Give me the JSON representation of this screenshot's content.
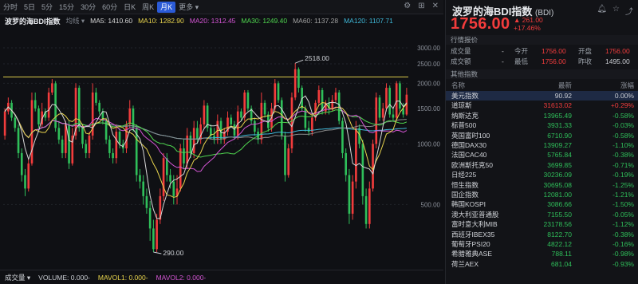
{
  "toolbar": {
    "tabs": [
      "分时",
      "5日",
      "5分",
      "15分",
      "30分",
      "60分",
      "日K",
      "周K",
      "月K",
      "更多"
    ],
    "active_tab": 8
  },
  "indicator_row": {
    "title": "波罗的海BDI指数",
    "mode": "均线",
    "ma5": "MA5: 1410.60",
    "ma10": "MA10: 1282.90",
    "ma20": "MA20: 1312.45",
    "ma30": "MA30: 1249.40",
    "ma60": "MA60: 1137.28",
    "ma120": "MA120: 1107.71",
    "colors": {
      "ma5": "#d7d7d7",
      "ma10": "#e8d44d",
      "ma20": "#d455d4",
      "ma30": "#4fd64f",
      "ma60": "#8c8c8c",
      "ma120": "#3fb8d8"
    }
  },
  "chart_data": {
    "type": "candlestick",
    "y_scale": "log",
    "ylim": [
      260,
      3600
    ],
    "y_ticks": [
      "3000.00",
      "2500.00",
      "2000.00",
      "1500.00",
      "1000.00",
      "500.00"
    ],
    "high_label": "2518.00",
    "low_label": "290.00",
    "high": 2518,
    "low": 290,
    "reference_line": 2150,
    "up_color": "#f23c3c",
    "down_color": "#2fbf5a",
    "candles": [
      [
        1100,
        1450,
        1050,
        1500
      ],
      [
        1450,
        1600,
        1400,
        1700
      ],
      [
        1600,
        1350,
        1300,
        1650
      ],
      [
        1350,
        1200,
        1150,
        1400
      ],
      [
        1200,
        900,
        850,
        1250
      ],
      [
        900,
        700,
        650,
        950
      ],
      [
        700,
        600,
        550,
        750
      ],
      [
        600,
        800,
        580,
        850
      ],
      [
        800,
        1650,
        780,
        1800
      ],
      [
        1650,
        1500,
        1450,
        1800
      ],
      [
        1500,
        1250,
        1200,
        1550
      ],
      [
        1250,
        1450,
        1200,
        1600
      ],
      [
        1450,
        1350,
        1300,
        1500
      ],
      [
        1350,
        1800,
        1300,
        1900
      ],
      [
        1800,
        2000,
        1750,
        2100
      ],
      [
        2000,
        1200,
        1150,
        2050
      ],
      [
        1200,
        1050,
        1000,
        1300
      ],
      [
        1050,
        900,
        850,
        1100
      ],
      [
        900,
        1250,
        850,
        1300
      ],
      [
        1250,
        800,
        750,
        1300
      ],
      [
        800,
        1100,
        780,
        1200
      ],
      [
        1100,
        1900,
        1050,
        2000
      ],
      [
        1900,
        1200,
        1150,
        1950
      ],
      [
        1200,
        1000,
        950,
        1250
      ],
      [
        1000,
        900,
        850,
        1050
      ],
      [
        900,
        1100,
        850,
        1150
      ],
      [
        1100,
        1800,
        1050,
        2000
      ],
      [
        1800,
        1600,
        1550,
        1900
      ],
      [
        1600,
        1450,
        1400,
        1650
      ],
      [
        1450,
        1300,
        1250,
        1500
      ],
      [
        1300,
        1050,
        1000,
        1350
      ],
      [
        1050,
        900,
        850,
        1100
      ],
      [
        900,
        850,
        800,
        950
      ],
      [
        850,
        1150,
        800,
        1250
      ],
      [
        1150,
        1000,
        950,
        1200
      ],
      [
        1000,
        950,
        900,
        1050
      ],
      [
        950,
        1250,
        900,
        1300
      ],
      [
        1250,
        1500,
        1200,
        1650
      ],
      [
        1500,
        1200,
        1150,
        1550
      ],
      [
        1200,
        700,
        650,
        1250
      ],
      [
        700,
        650,
        600,
        750
      ],
      [
        650,
        550,
        500,
        700
      ],
      [
        550,
        480,
        450,
        600
      ],
      [
        480,
        380,
        330,
        520
      ],
      [
        380,
        300,
        290,
        420
      ],
      [
        300,
        420,
        290,
        450
      ],
      [
        420,
        550,
        400,
        600
      ],
      [
        550,
        850,
        520,
        900
      ],
      [
        850,
        700,
        650,
        900
      ],
      [
        700,
        650,
        600,
        750
      ],
      [
        650,
        550,
        500,
        700
      ],
      [
        550,
        600,
        500,
        700
      ],
      [
        600,
        950,
        580,
        1000
      ],
      [
        950,
        800,
        750,
        1050
      ],
      [
        800,
        1100,
        750,
        1200
      ],
      [
        1100,
        900,
        850,
        1150
      ],
      [
        900,
        1200,
        850,
        1300
      ],
      [
        1200,
        1050,
        1000,
        1300
      ],
      [
        1050,
        1250,
        1000,
        1350
      ],
      [
        1250,
        1550,
        1200,
        1650
      ],
      [
        1550,
        1200,
        1150,
        1600
      ],
      [
        1200,
        1100,
        1050,
        1250
      ],
      [
        1100,
        1050,
        1000,
        1200
      ],
      [
        1050,
        1300,
        1000,
        1400
      ],
      [
        1300,
        1050,
        1000,
        1350
      ],
      [
        1050,
        1150,
        1000,
        1200
      ],
      [
        1150,
        1350,
        1100,
        1450
      ],
      [
        1350,
        1250,
        1200,
        1400
      ],
      [
        1250,
        1100,
        1050,
        1300
      ],
      [
        1100,
        1450,
        1050,
        1550
      ],
      [
        1450,
        1350,
        1300,
        1500
      ],
      [
        1350,
        1800,
        1300,
        1850
      ],
      [
        1800,
        1500,
        1450,
        1850
      ],
      [
        1500,
        1300,
        1250,
        1550
      ],
      [
        1300,
        1150,
        1100,
        1350
      ],
      [
        1150,
        1050,
        1000,
        1200
      ],
      [
        1050,
        1600,
        1000,
        1800
      ],
      [
        1600,
        1400,
        1350,
        1650
      ],
      [
        1400,
        1200,
        1150,
        1450
      ],
      [
        1200,
        1500,
        1150,
        1600
      ],
      [
        1500,
        2000,
        1450,
        2100
      ],
      [
        2000,
        1650,
        1600,
        2050
      ],
      [
        1650,
        1100,
        1050,
        1700
      ],
      [
        1100,
        700,
        650,
        1150
      ],
      [
        700,
        950,
        680,
        1000
      ],
      [
        950,
        1700,
        900,
        1800
      ],
      [
        1700,
        2350,
        1650,
        2518
      ],
      [
        2350,
        1900,
        1800,
        2400
      ],
      [
        1900,
        1500,
        1450,
        1950
      ],
      [
        1500,
        1200,
        1150,
        1550
      ],
      [
        1200,
        1150,
        1100,
        1300
      ],
      [
        1150,
        1350,
        1100,
        1400
      ],
      [
        1350,
        1600,
        1300,
        1650
      ],
      [
        1600,
        1850,
        1550,
        1950
      ],
      [
        1850,
        1450,
        1400,
        1900
      ],
      [
        1450,
        1600,
        1400,
        1650
      ],
      [
        1600,
        1500,
        1400,
        1700
      ],
      [
        1500,
        1650,
        1450,
        1750
      ],
      [
        1650,
        1800,
        1600,
        1900
      ],
      [
        1800,
        1300,
        1250,
        1850
      ],
      [
        1300,
        900,
        850,
        1350
      ],
      [
        900,
        700,
        650,
        950
      ],
      [
        700,
        450,
        400,
        750
      ],
      [
        450,
        650,
        420,
        700
      ],
      [
        650,
        1200,
        600,
        1300
      ],
      [
        1200,
        1000,
        950,
        1250
      ],
      [
        1000,
        550,
        500,
        1050
      ],
      [
        550,
        400,
        380,
        600
      ],
      [
        400,
        600,
        380,
        650
      ],
      [
        600,
        1000,
        580,
        1050
      ],
      [
        1000,
        1700,
        950,
        1800
      ],
      [
        1700,
        1350,
        1300,
        1750
      ],
      [
        1350,
        1500,
        1300,
        1600
      ],
      [
        1500,
        1900,
        1450,
        2000
      ],
      [
        1900,
        1400,
        1350,
        1950
      ],
      [
        1400,
        1350,
        1300,
        1500
      ],
      [
        1350,
        2000,
        1300,
        2050
      ],
      [
        2000,
        1500,
        1450,
        2050
      ],
      [
        1500,
        1400,
        1350,
        1600
      ],
      [
        1400,
        1756,
        1380,
        1900
      ]
    ]
  },
  "volume_row": {
    "title": "成交量",
    "volume": "VOLUME: 0.000-",
    "mavol1": "MAVOL1: 0.000-",
    "mavol2": "MAVOL2: 0.000-"
  },
  "panel": {
    "title": "波罗的海BDI指数",
    "code": "(BDI)",
    "price": "1756.00",
    "change": "▲ 261.00",
    "change_pct": "+17.46%",
    "quote_header": "行情报价",
    "quote_rows": [
      {
        "l1": "成交量",
        "v1": "-",
        "l2": "今开",
        "v2": "1756.00",
        "l3": "开盘",
        "v3": "1756.00"
      },
      {
        "l1": "成交额",
        "v1": "-",
        "l2": "最低",
        "v2": "1756.00",
        "l3": "昨收",
        "v3": "1495.00"
      }
    ],
    "other_header": "其他指数",
    "col_name": "名称",
    "col_last": "最新",
    "col_chg": "涨幅",
    "indices": [
      {
        "name": "美元指数",
        "last": "90.92",
        "chg": "0.00%",
        "dir": "flat"
      },
      {
        "name": "道琼斯",
        "last": "31613.02",
        "chg": "+0.29%",
        "dir": "up"
      },
      {
        "name": "纳斯达克",
        "last": "13965.49",
        "chg": "-0.58%",
        "dir": "down"
      },
      {
        "name": "标普500",
        "last": "3931.33",
        "chg": "-0.03%",
        "dir": "down"
      },
      {
        "name": "英国富时100",
        "last": "6710.90",
        "chg": "-0.58%",
        "dir": "down"
      },
      {
        "name": "德国DAX30",
        "last": "13909.27",
        "chg": "-1.10%",
        "dir": "down"
      },
      {
        "name": "法国CAC40",
        "last": "5765.84",
        "chg": "-0.38%",
        "dir": "down"
      },
      {
        "name": "欧洲斯托克50",
        "last": "3699.85",
        "chg": "-0.71%",
        "dir": "down"
      },
      {
        "name": "日经225",
        "last": "30236.09",
        "chg": "-0.19%",
        "dir": "down"
      },
      {
        "name": "恒生指数",
        "last": "30695.08",
        "chg": "-1.25%",
        "dir": "down"
      },
      {
        "name": "国企指数",
        "last": "12081.00",
        "chg": "-1.21%",
        "dir": "down"
      },
      {
        "name": "韩国KOSPI",
        "last": "3086.66",
        "chg": "-1.50%",
        "dir": "down"
      },
      {
        "name": "澳大利亚普通股",
        "last": "7155.50",
        "chg": "-0.05%",
        "dir": "down"
      },
      {
        "name": "富时意大利MIB",
        "last": "23178.56",
        "chg": "-1.12%",
        "dir": "down"
      },
      {
        "name": "西班牙IBEX35",
        "last": "8122.70",
        "chg": "-0.38%",
        "dir": "down"
      },
      {
        "name": "葡萄牙PSI20",
        "last": "4822.12",
        "chg": "-0.16%",
        "dir": "down"
      },
      {
        "name": "希腊雅典ASE",
        "last": "788.11",
        "chg": "-0.98%",
        "dir": "down"
      },
      {
        "name": "荷兰AEX",
        "last": "681.04",
        "chg": "-0.93%",
        "dir": "down"
      }
    ]
  }
}
